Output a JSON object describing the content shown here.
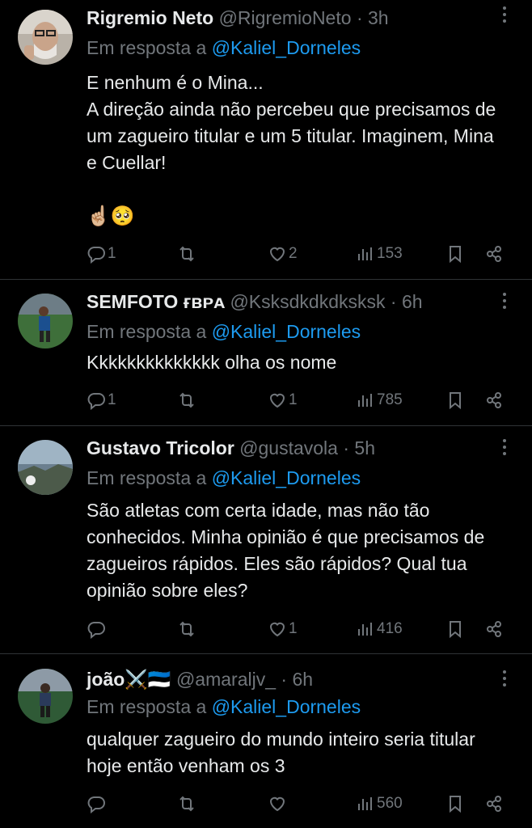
{
  "tweets": [
    {
      "name": "Rigremio Neto",
      "handle": "@RigremioNeto",
      "dot": "·",
      "time": "3h",
      "reply_prefix": "Em resposta a",
      "reply_to": "@Kaliel_Dorneles",
      "text": "E nenhum é o Mina...\nA direção ainda não percebeu que precisamos de um zagueiro titular e um 5 titular. Imaginem, Mina e Cuellar!",
      "emojis": "☝🏼🥺",
      "replies": "1",
      "retweets": "",
      "likes": "2",
      "views": "153"
    },
    {
      "name": "SEMFOTO ғʙᴘᴀ",
      "handle": "@Ksksdkdkdksksk",
      "dot": "·",
      "time": "6h",
      "reply_prefix": "Em resposta a",
      "reply_to": "@Kaliel_Dorneles",
      "text": "Kkkkkkkkkkkkkk olha os nome",
      "replies": "1",
      "retweets": "",
      "likes": "1",
      "views": "785"
    },
    {
      "name": "Gustavo Tricolor",
      "handle": "@gustavola",
      "dot": "·",
      "time": "5h",
      "reply_prefix": "Em resposta a",
      "reply_to": "@Kaliel_Dorneles",
      "text": "São atletas com certa idade, mas não tão conhecidos. Minha opinião é que precisamos de zagueiros rápidos. Eles são rápidos? Qual tua opinião sobre eles?",
      "replies": "",
      "retweets": "",
      "likes": "1",
      "views": "416"
    },
    {
      "name": "joão⚔️🇪🇪",
      "handle": "@amaraljv_",
      "dot": "·",
      "time": "6h",
      "reply_prefix": "Em resposta a",
      "reply_to": "@Kaliel_Dorneles",
      "text": "qualquer zagueiro do mundo inteiro seria titular hoje então venham os 3",
      "replies": "",
      "retweets": "",
      "likes": "",
      "views": "560"
    }
  ],
  "icons": {
    "reply": "reply-icon",
    "retweet": "retweet-icon",
    "like": "heart-icon",
    "views": "views-icon",
    "bookmark": "bookmark-icon",
    "share": "share-icon",
    "more": "more-icon"
  },
  "colors": {
    "background": "#000000",
    "text": "#e7e9ea",
    "muted": "#71767b",
    "link": "#1d9bf0",
    "divider": "#2f3336"
  }
}
